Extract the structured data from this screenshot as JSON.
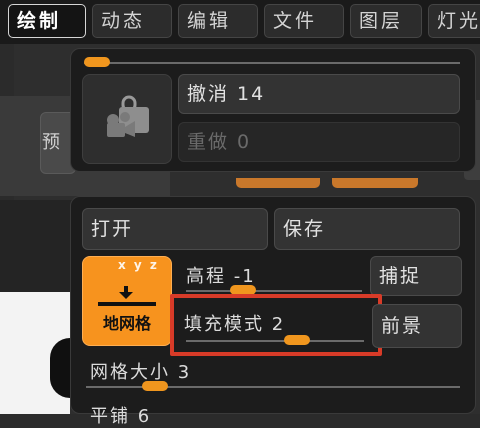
{
  "menu": {
    "tabs": [
      {
        "label": "绘制",
        "active": true
      },
      {
        "label": "动态",
        "active": false
      },
      {
        "label": "编辑",
        "active": false
      },
      {
        "label": "文件",
        "active": false
      },
      {
        "label": "图层",
        "active": false
      },
      {
        "label": "灯光",
        "active": false
      }
    ]
  },
  "left_panel": {
    "label": "预"
  },
  "history_popup": {
    "undo_label": "撤消 14",
    "redo_label": "重做 0",
    "camera_icon": "camera-lock-icon"
  },
  "grid_popup": {
    "open_label": "打开",
    "save_label": "保存",
    "floor_button": {
      "label": "地网格",
      "axes": "x y z",
      "icon": "floor-arrow-icon"
    },
    "elevation_label": "高程 -1",
    "snap_label": "捕捉",
    "fill_mode_label": "填充模式 2",
    "foreground_label": "前景",
    "grid_size_label": "网格大小 3",
    "tiling_label": "平铺 6"
  },
  "colors": {
    "accent_orange": "#f0961e",
    "highlight_red": "#d83b28",
    "panel_bg": "#1c1c1c"
  }
}
